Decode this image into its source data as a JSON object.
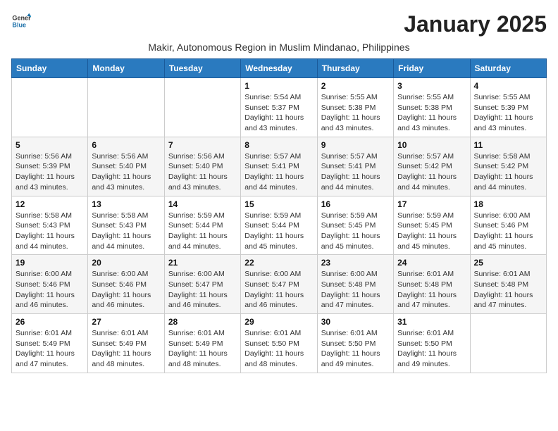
{
  "logo": {
    "line1": "General",
    "line2": "Blue"
  },
  "title": "January 2025",
  "subtitle": "Makir, Autonomous Region in Muslim Mindanao, Philippines",
  "headers": [
    "Sunday",
    "Monday",
    "Tuesday",
    "Wednesday",
    "Thursday",
    "Friday",
    "Saturday"
  ],
  "weeks": [
    [
      {
        "num": "",
        "info": ""
      },
      {
        "num": "",
        "info": ""
      },
      {
        "num": "",
        "info": ""
      },
      {
        "num": "1",
        "info": "Sunrise: 5:54 AM\nSunset: 5:37 PM\nDaylight: 11 hours and 43 minutes."
      },
      {
        "num": "2",
        "info": "Sunrise: 5:55 AM\nSunset: 5:38 PM\nDaylight: 11 hours and 43 minutes."
      },
      {
        "num": "3",
        "info": "Sunrise: 5:55 AM\nSunset: 5:38 PM\nDaylight: 11 hours and 43 minutes."
      },
      {
        "num": "4",
        "info": "Sunrise: 5:55 AM\nSunset: 5:39 PM\nDaylight: 11 hours and 43 minutes."
      }
    ],
    [
      {
        "num": "5",
        "info": "Sunrise: 5:56 AM\nSunset: 5:39 PM\nDaylight: 11 hours and 43 minutes."
      },
      {
        "num": "6",
        "info": "Sunrise: 5:56 AM\nSunset: 5:40 PM\nDaylight: 11 hours and 43 minutes."
      },
      {
        "num": "7",
        "info": "Sunrise: 5:56 AM\nSunset: 5:40 PM\nDaylight: 11 hours and 43 minutes."
      },
      {
        "num": "8",
        "info": "Sunrise: 5:57 AM\nSunset: 5:41 PM\nDaylight: 11 hours and 44 minutes."
      },
      {
        "num": "9",
        "info": "Sunrise: 5:57 AM\nSunset: 5:41 PM\nDaylight: 11 hours and 44 minutes."
      },
      {
        "num": "10",
        "info": "Sunrise: 5:57 AM\nSunset: 5:42 PM\nDaylight: 11 hours and 44 minutes."
      },
      {
        "num": "11",
        "info": "Sunrise: 5:58 AM\nSunset: 5:42 PM\nDaylight: 11 hours and 44 minutes."
      }
    ],
    [
      {
        "num": "12",
        "info": "Sunrise: 5:58 AM\nSunset: 5:43 PM\nDaylight: 11 hours and 44 minutes."
      },
      {
        "num": "13",
        "info": "Sunrise: 5:58 AM\nSunset: 5:43 PM\nDaylight: 11 hours and 44 minutes."
      },
      {
        "num": "14",
        "info": "Sunrise: 5:59 AM\nSunset: 5:44 PM\nDaylight: 11 hours and 44 minutes."
      },
      {
        "num": "15",
        "info": "Sunrise: 5:59 AM\nSunset: 5:44 PM\nDaylight: 11 hours and 45 minutes."
      },
      {
        "num": "16",
        "info": "Sunrise: 5:59 AM\nSunset: 5:45 PM\nDaylight: 11 hours and 45 minutes."
      },
      {
        "num": "17",
        "info": "Sunrise: 5:59 AM\nSunset: 5:45 PM\nDaylight: 11 hours and 45 minutes."
      },
      {
        "num": "18",
        "info": "Sunrise: 6:00 AM\nSunset: 5:46 PM\nDaylight: 11 hours and 45 minutes."
      }
    ],
    [
      {
        "num": "19",
        "info": "Sunrise: 6:00 AM\nSunset: 5:46 PM\nDaylight: 11 hours and 46 minutes."
      },
      {
        "num": "20",
        "info": "Sunrise: 6:00 AM\nSunset: 5:46 PM\nDaylight: 11 hours and 46 minutes."
      },
      {
        "num": "21",
        "info": "Sunrise: 6:00 AM\nSunset: 5:47 PM\nDaylight: 11 hours and 46 minutes."
      },
      {
        "num": "22",
        "info": "Sunrise: 6:00 AM\nSunset: 5:47 PM\nDaylight: 11 hours and 46 minutes."
      },
      {
        "num": "23",
        "info": "Sunrise: 6:00 AM\nSunset: 5:48 PM\nDaylight: 11 hours and 47 minutes."
      },
      {
        "num": "24",
        "info": "Sunrise: 6:01 AM\nSunset: 5:48 PM\nDaylight: 11 hours and 47 minutes."
      },
      {
        "num": "25",
        "info": "Sunrise: 6:01 AM\nSunset: 5:48 PM\nDaylight: 11 hours and 47 minutes."
      }
    ],
    [
      {
        "num": "26",
        "info": "Sunrise: 6:01 AM\nSunset: 5:49 PM\nDaylight: 11 hours and 47 minutes."
      },
      {
        "num": "27",
        "info": "Sunrise: 6:01 AM\nSunset: 5:49 PM\nDaylight: 11 hours and 48 minutes."
      },
      {
        "num": "28",
        "info": "Sunrise: 6:01 AM\nSunset: 5:49 PM\nDaylight: 11 hours and 48 minutes."
      },
      {
        "num": "29",
        "info": "Sunrise: 6:01 AM\nSunset: 5:50 PM\nDaylight: 11 hours and 48 minutes."
      },
      {
        "num": "30",
        "info": "Sunrise: 6:01 AM\nSunset: 5:50 PM\nDaylight: 11 hours and 49 minutes."
      },
      {
        "num": "31",
        "info": "Sunrise: 6:01 AM\nSunset: 5:50 PM\nDaylight: 11 hours and 49 minutes."
      },
      {
        "num": "",
        "info": ""
      }
    ]
  ]
}
